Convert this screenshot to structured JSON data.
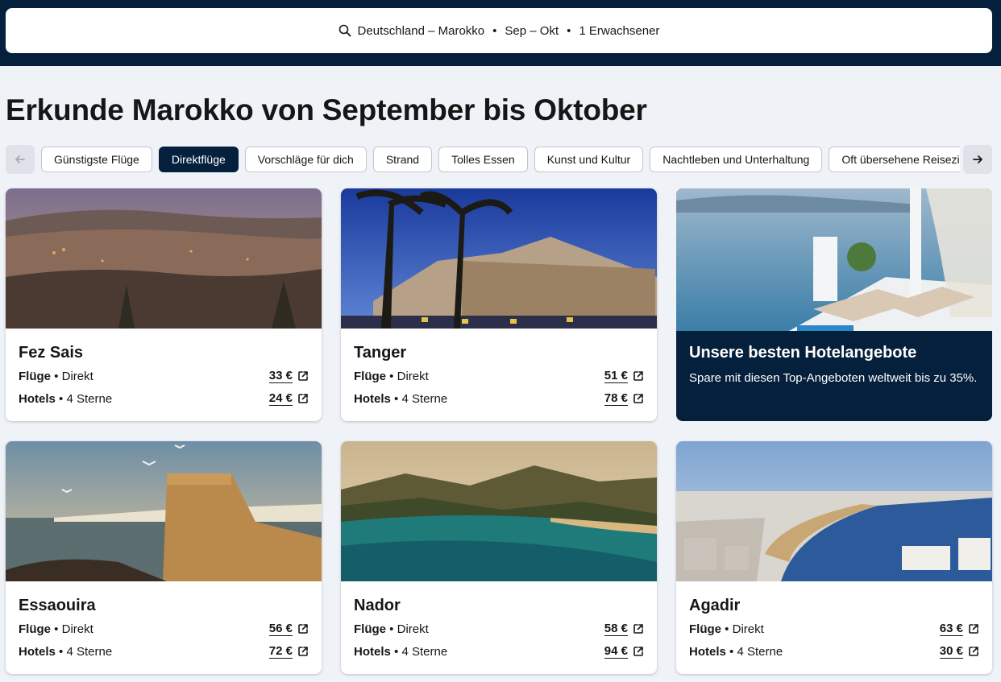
{
  "search": {
    "route": "Deutschland – Marokko",
    "dates": "Sep – Okt",
    "travellers": "1 Erwachsener",
    "separator": "•"
  },
  "page_title": "Erkunde Marokko von September bis Oktober",
  "filters": [
    {
      "label": "Günstigste Flüge",
      "active": false
    },
    {
      "label": "Direktflüge",
      "active": true
    },
    {
      "label": "Vorschläge für dich",
      "active": false
    },
    {
      "label": "Strand",
      "active": false
    },
    {
      "label": "Tolles Essen",
      "active": false
    },
    {
      "label": "Kunst und Kultur",
      "active": false
    },
    {
      "label": "Nachtleben und Unterhaltung",
      "active": false
    },
    {
      "label": "Oft übersehene Reiseziele",
      "active": false
    }
  ],
  "labels": {
    "flights": "Flüge",
    "flights_type": "Direkt",
    "hotels": "Hotels",
    "hotels_type": "4 Sterne",
    "dot": "•"
  },
  "destinations": [
    {
      "city": "Fez Sais",
      "flight_price": "33 €",
      "hotel_price": "24 €"
    },
    {
      "city": "Tanger",
      "flight_price": "51 €",
      "hotel_price": "78 €"
    },
    {
      "city": "Essaouira",
      "flight_price": "56 €",
      "hotel_price": "72 €"
    },
    {
      "city": "Nador",
      "flight_price": "58 €",
      "hotel_price": "94 €"
    },
    {
      "city": "Agadir",
      "flight_price": "63 €",
      "hotel_price": "30 €"
    }
  ],
  "promo": {
    "title": "Unsere besten Hotelangebote",
    "text": "Spare mit diesen Top-Angeboten weltweit bis zu 35%."
  },
  "colors": {
    "brand_dark": "#05203c",
    "background": "#eff3f8"
  }
}
